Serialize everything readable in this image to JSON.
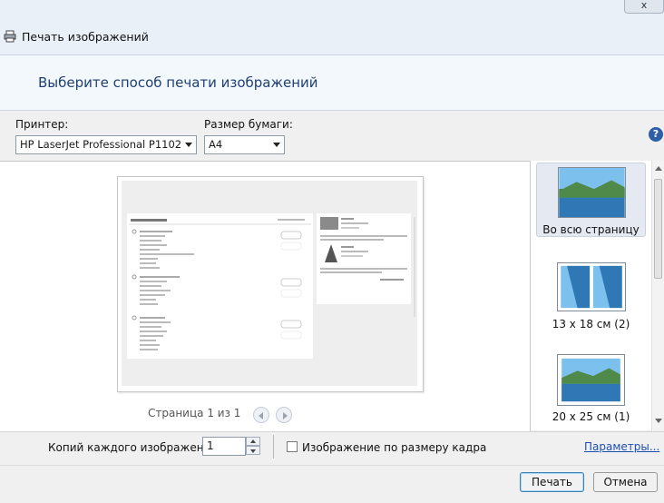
{
  "window": {
    "close_label": "x",
    "title": "Печать изображений"
  },
  "header": {
    "title": "Выберите способ печати изображений"
  },
  "printer": {
    "label": "Принтер:",
    "value": "HP LaserJet Professional P1102"
  },
  "paper": {
    "label": "Размер бумаги:",
    "value": "A4"
  },
  "help_label": "?",
  "preview": {
    "page_status": "Страница 1 из 1"
  },
  "layouts": [
    {
      "label": "Во всю страницу",
      "selected": true
    },
    {
      "label": "13 x 18 см (2)",
      "selected": false
    },
    {
      "label": "20 x 25 см (1)",
      "selected": false
    }
  ],
  "copies": {
    "label": "Копий каждого изображения:",
    "value": "1"
  },
  "fit_frame": {
    "label": "Изображение по размеру кадра",
    "checked": false
  },
  "options_link": "Параметры...",
  "buttons": {
    "print": "Печать",
    "cancel": "Отмена"
  },
  "colors": {
    "accent": "#1f3f73",
    "link": "#1d4fb3",
    "sky": "#6fb6e8",
    "water": "#2f77b5",
    "hills": "#3f7a3c"
  },
  "icons": {
    "title": "printer-icon",
    "help": "help-icon",
    "prev": "arrow-left-icon",
    "next": "arrow-right-icon"
  }
}
